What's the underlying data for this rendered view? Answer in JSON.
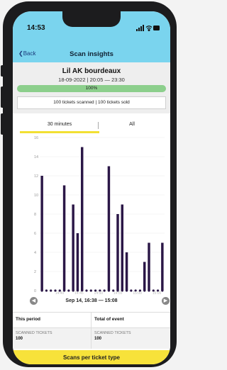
{
  "status_bar": {
    "time": "14:53"
  },
  "nav": {
    "back_label": "Back",
    "title": "Scan insights"
  },
  "event": {
    "title": "Lil AK bourdeaux",
    "date_range": "18-09-2022 | 20:05 — 23:30",
    "progress_percent": 100,
    "progress_label": "100%",
    "summary": "100 tickets scanned | 100 tickets sold"
  },
  "tabs": [
    {
      "label": "30 minutes",
      "active": true
    },
    {
      "label": "All",
      "active": false
    }
  ],
  "chart_data": {
    "type": "bar",
    "ylim": [
      0,
      16
    ],
    "y_ticks": [
      "0",
      "2",
      "4",
      "6",
      "8",
      "10",
      "12",
      "14",
      "16"
    ],
    "x_tick_labels": [
      "14:40",
      "14:45",
      "14:50",
      "14:55",
      "15:00",
      "15:05"
    ],
    "values": [
      12,
      0,
      0,
      0,
      0,
      11,
      0,
      9,
      6,
      15,
      0,
      0,
      0,
      0,
      0,
      13,
      0,
      8,
      9,
      4,
      0,
      0,
      0,
      3,
      5,
      0,
      0,
      5
    ],
    "bar_color": "#2b1747"
  },
  "range_label": "Sep 14, 16:38 — 15:08",
  "stats": {
    "left_title": "This period",
    "right_title": "Total of event",
    "left_label": "SCANNED TICKETS",
    "left_value": "100",
    "right_label": "SCANNED TICKETS",
    "right_value": "100"
  },
  "bottom_button": "Scans per ticket type",
  "colors": {
    "header": "#7ad4ee",
    "accent": "#f7e23a",
    "progress": "#8ccf8c"
  }
}
